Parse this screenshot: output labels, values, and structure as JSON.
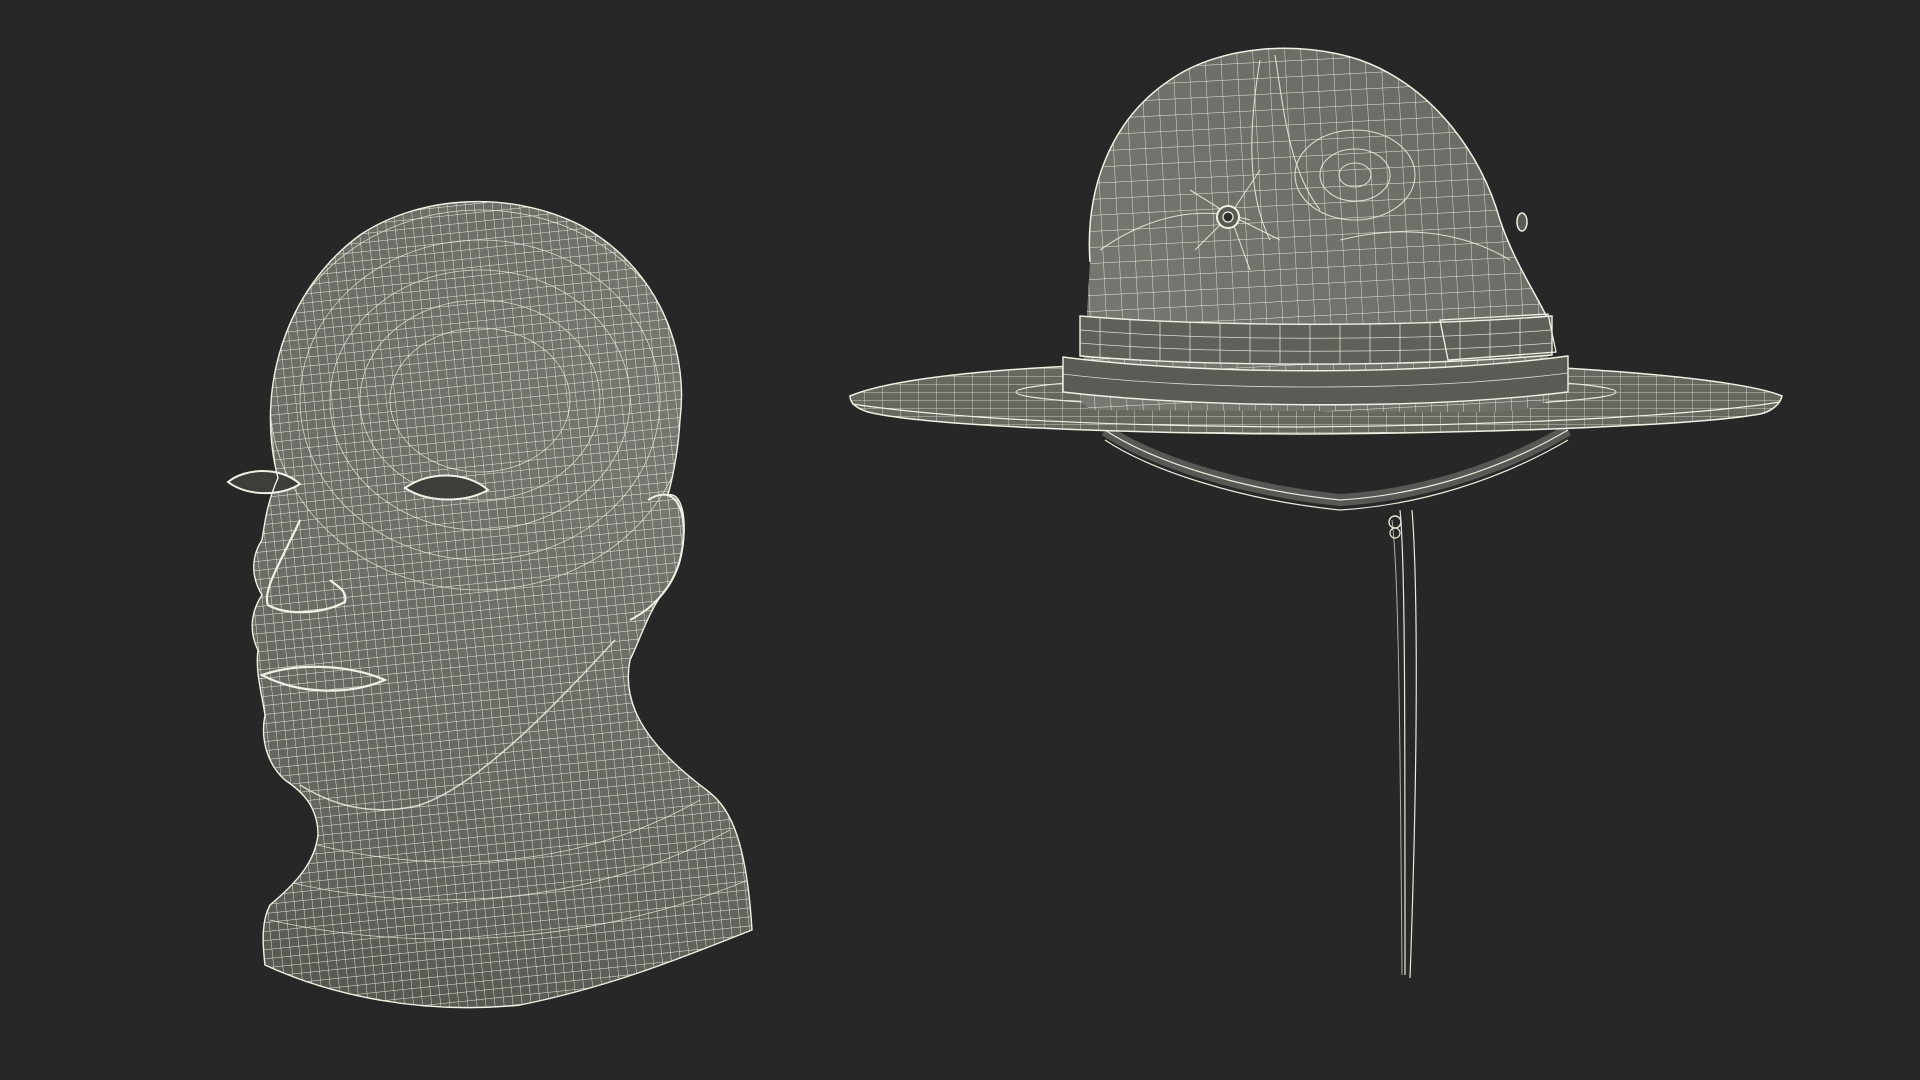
{
  "scene": {
    "background_color": "#272727",
    "model_surface_color": "#6f706a",
    "model_shadow_color": "#4a4b46",
    "wire_color": "#e9e8dc",
    "objects": [
      "wireframe-head",
      "wireframe-campaign-hat"
    ]
  }
}
